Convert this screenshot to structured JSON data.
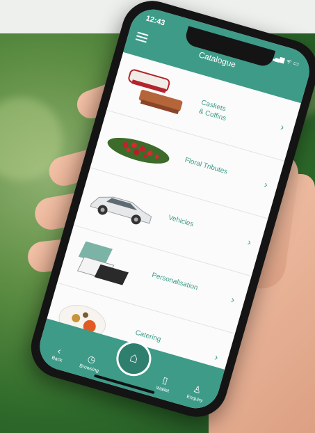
{
  "status_bar": {
    "time": "12:43",
    "icons": "▂▄▆ ᯤ ▭"
  },
  "header": {
    "title": "Catalogue",
    "menu_icon": "hamburger-icon"
  },
  "catalogue": {
    "items": [
      {
        "label": "Caskets\n& Coffins",
        "chevron": "›"
      },
      {
        "label": "Floral Tributes",
        "chevron": "›"
      },
      {
        "label": "Vehicles",
        "chevron": "›"
      },
      {
        "label": "Personalisation",
        "chevron": "›"
      },
      {
        "label": "Catering",
        "chevron": "›"
      }
    ]
  },
  "tabbar": {
    "back_label": "Back",
    "history_label": "Browsing",
    "home_label": "",
    "wallet_label": "Wallet",
    "profile_label": "Enquiry"
  },
  "colors": {
    "accent": "#3d9b88",
    "background_green": "#2e6a2a"
  }
}
